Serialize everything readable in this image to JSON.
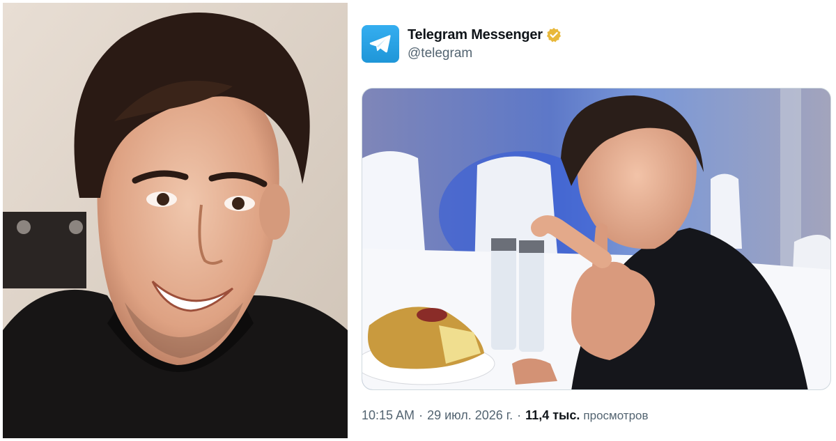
{
  "tweet": {
    "display_name": "Telegram Messenger",
    "handle": "@telegram",
    "time": "10:15 AM",
    "separator": "·",
    "date": "29 июл. 2026 г.",
    "views_count": "11,4 тыс.",
    "views_label": "просмотров"
  },
  "icons": {
    "avatar": "telegram-paper-plane-icon",
    "verified": "gold-verified-badge-icon"
  },
  "colors": {
    "telegram_blue": "#2aa3e6",
    "verified_gold": "#e8b83a",
    "text_primary": "#0f1419",
    "text_secondary": "#536471"
  }
}
